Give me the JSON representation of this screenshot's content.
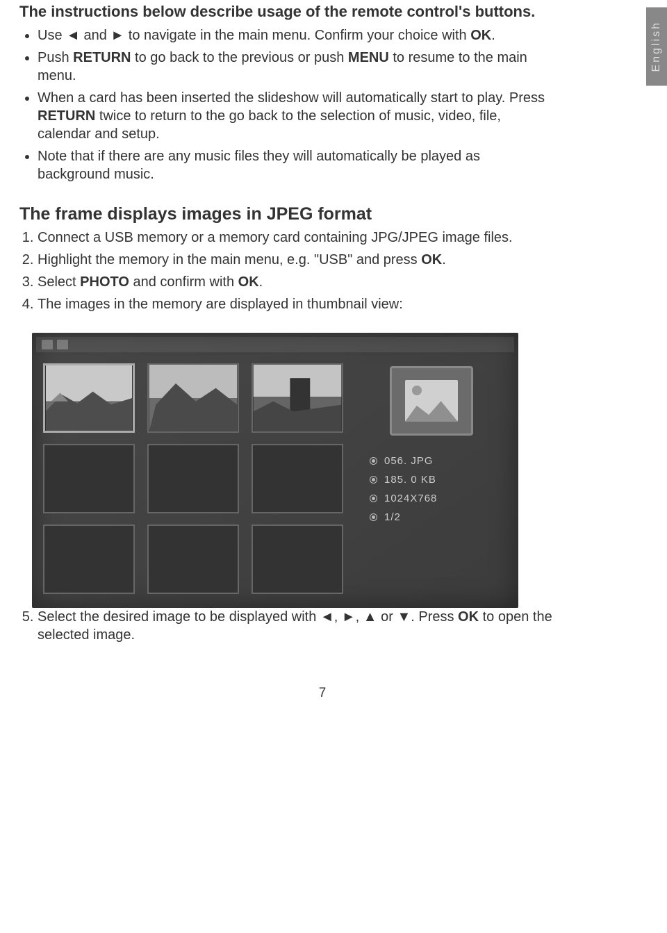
{
  "language_tab": "English",
  "intro_heading": "The instructions below describe usage of the remote control's buttons.",
  "bullets": {
    "b1_pre": "Use ",
    "b1_arrow_left": "◄",
    "b1_mid": " and ",
    "b1_arrow_right": "►",
    "b1_post": " to navigate in the main menu. Confirm your choice with ",
    "b1_ok": "OK",
    "b1_end": ".",
    "b2_pre": "Push ",
    "b2_return": "RETURN",
    "b2_mid": " to go back to the previous or push ",
    "b2_menu": "MENU",
    "b2_post": " to resume to the main menu.",
    "b3_line1": "When a card has been inserted the slideshow will automatically start to play. Press ",
    "b3_return": "RETURN",
    "b3_line2": " twice to return to the go back to the selection of music, video, file, calendar and setup.",
    "b4": "Note that if there are any music files they will automatically be played as background music."
  },
  "section_heading": "The frame displays images in JPEG format",
  "steps": {
    "s1": "Connect a USB memory or a memory card containing JPG/JPEG image files.",
    "s2_pre": "Highlight the memory in the main menu, e.g. \"USB\" and press ",
    "s2_ok": "OK",
    "s2_end": ".",
    "s3_pre": "Select ",
    "s3_photo": "PHOTO",
    "s3_mid": " and confirm with ",
    "s3_ok": "OK",
    "s3_end": ".",
    "s4": "The images in the memory are displayed in thumbnail view:",
    "s5_pre": "Select the desired image to be displayed with ",
    "s5_a1": "◄",
    "s5_c1": ", ",
    "s5_a2": "►",
    "s5_c2": ", ",
    "s5_a3": "▲",
    "s5_c3": " or ",
    "s5_a4": "▼",
    "s5_mid": ". Press ",
    "s5_ok": "OK",
    "s5_end": " to open the selected image."
  },
  "meta": {
    "filename": "056. JPG",
    "filesize": "185. 0 KB",
    "resolution": "1024X768",
    "page": "1/2"
  },
  "page_number": "7"
}
